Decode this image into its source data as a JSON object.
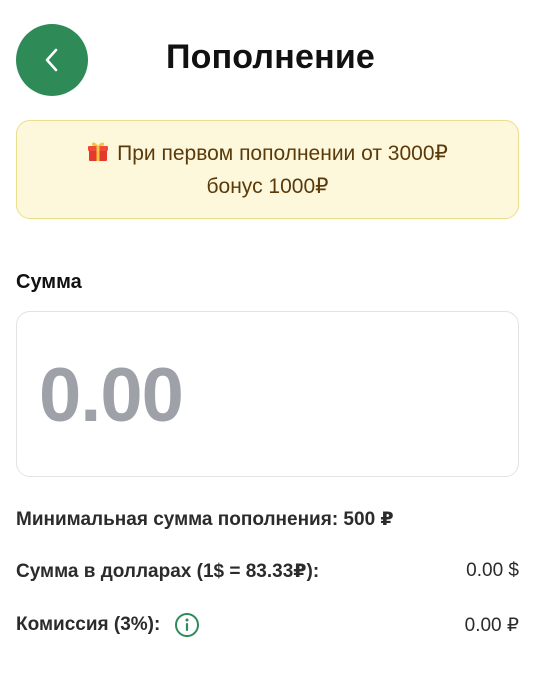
{
  "header": {
    "title": "Пополнение",
    "back_icon": "chevron-left-icon",
    "accent_color": "#2e8b57"
  },
  "bonus": {
    "icon": "gift-icon",
    "line1": "При первом пополнении от 3000₽",
    "line2": "бонус 1000₽"
  },
  "amount": {
    "label": "Сумма",
    "placeholder": "0.00",
    "value": ""
  },
  "details": {
    "min_label": "Минимальная сумма пополнения: 500 ₽",
    "usd_label": "Сумма в долларах (1$ = 83.33₽):",
    "usd_value": "0.00 $",
    "fee_label": "Комиссия (3%):",
    "fee_icon": "info-icon",
    "fee_value": "0.00 ₽"
  }
}
